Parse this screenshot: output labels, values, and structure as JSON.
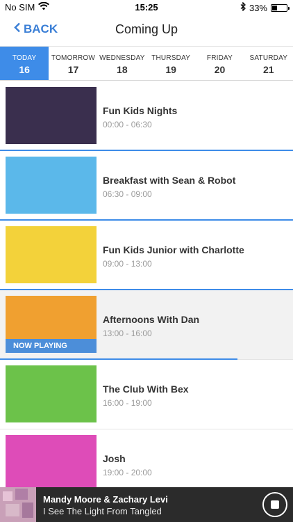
{
  "status_bar": {
    "carrier": "No SIM",
    "time": "15:25",
    "battery": "33%",
    "battery_level": 0.33
  },
  "nav": {
    "back_label": "BACK",
    "title": "Coming Up"
  },
  "days": [
    {
      "day": "TODAY",
      "date": "16",
      "active": true
    },
    {
      "day": "TOMORROW",
      "date": "17",
      "active": false
    },
    {
      "day": "WEDNESDAY",
      "date": "18",
      "active": false
    },
    {
      "day": "THURSDAY",
      "date": "19",
      "active": false
    },
    {
      "day": "FRIDAY",
      "date": "20",
      "active": false
    },
    {
      "day": "SATURDAY",
      "date": "21",
      "active": false
    }
  ],
  "schedule": [
    {
      "title": "Fun Kids Nights",
      "time": "00:00 - 06:30",
      "progress": 1.0,
      "thumb_color": "#3a2f4e"
    },
    {
      "title": "Breakfast with Sean & Robot",
      "time": "06:30 - 09:00",
      "progress": 1.0,
      "thumb_color": "#5bb8ea"
    },
    {
      "title": "Fun Kids Junior with Charlotte",
      "time": "09:00 - 13:00",
      "progress": 1.0,
      "thumb_color": "#f3d23a"
    },
    {
      "title": "Afternoons With Dan",
      "time": "13:00 - 16:00",
      "progress": 0.81,
      "thumb_color": "#f0a030",
      "now_playing": "NOW PLAYING"
    },
    {
      "title": "The Club With Bex",
      "time": "16:00 - 19:00",
      "progress": 0,
      "thumb_color": "#6cc24a"
    },
    {
      "title": "Josh",
      "time": "19:00 - 20:00",
      "progress": 0,
      "thumb_color": "#de4cb8"
    }
  ],
  "player": {
    "artist": "Mandy Moore & Zachary Levi",
    "track": "I See The Light From Tangled"
  }
}
